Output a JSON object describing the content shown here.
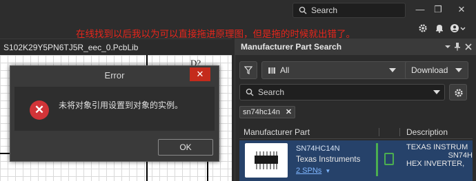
{
  "topbar": {
    "search_placeholder": "Search",
    "minimize_glyph": "—",
    "restore_glyph": "❐",
    "close_glyph": "✕"
  },
  "annotation": "在线找到以后我以为可以直接拖进原理图，但是拖的时候就出错了。",
  "document": {
    "tab_title": "S102K29Y5PN6TJ5R_eec_0.PcbLib",
    "canvas_label": "D?"
  },
  "dialog": {
    "title": "Error",
    "close_glyph": "✕",
    "icon_glyph": "✕",
    "message": "未将对象引用设置到对象的实例。",
    "ok_label": "OK"
  },
  "panel": {
    "title": "Manufacturer Part Search",
    "filter_select": "All",
    "download_label": "Download",
    "search_placeholder": "Search",
    "active_filter_chip": "sn74hc14n",
    "chip_remove_glyph": "✕",
    "columns": [
      "Manufacturer Part",
      "Description"
    ],
    "result": {
      "part_number": "SN74HC14N",
      "manufacturer": "Texas Instruments",
      "spns": "2 SPNs",
      "description_lines": [
        "TEXAS INSTRUM",
        "SN74H",
        "HEX INVERTER,"
      ]
    }
  },
  "colors": {
    "annotation_text": "#e8261c",
    "error_icon": "#d13438",
    "close_button": "#c42b1c",
    "result_row_bg": "#26426a",
    "link_text": "#7fb6ff",
    "stock_green": "#4caf50"
  }
}
